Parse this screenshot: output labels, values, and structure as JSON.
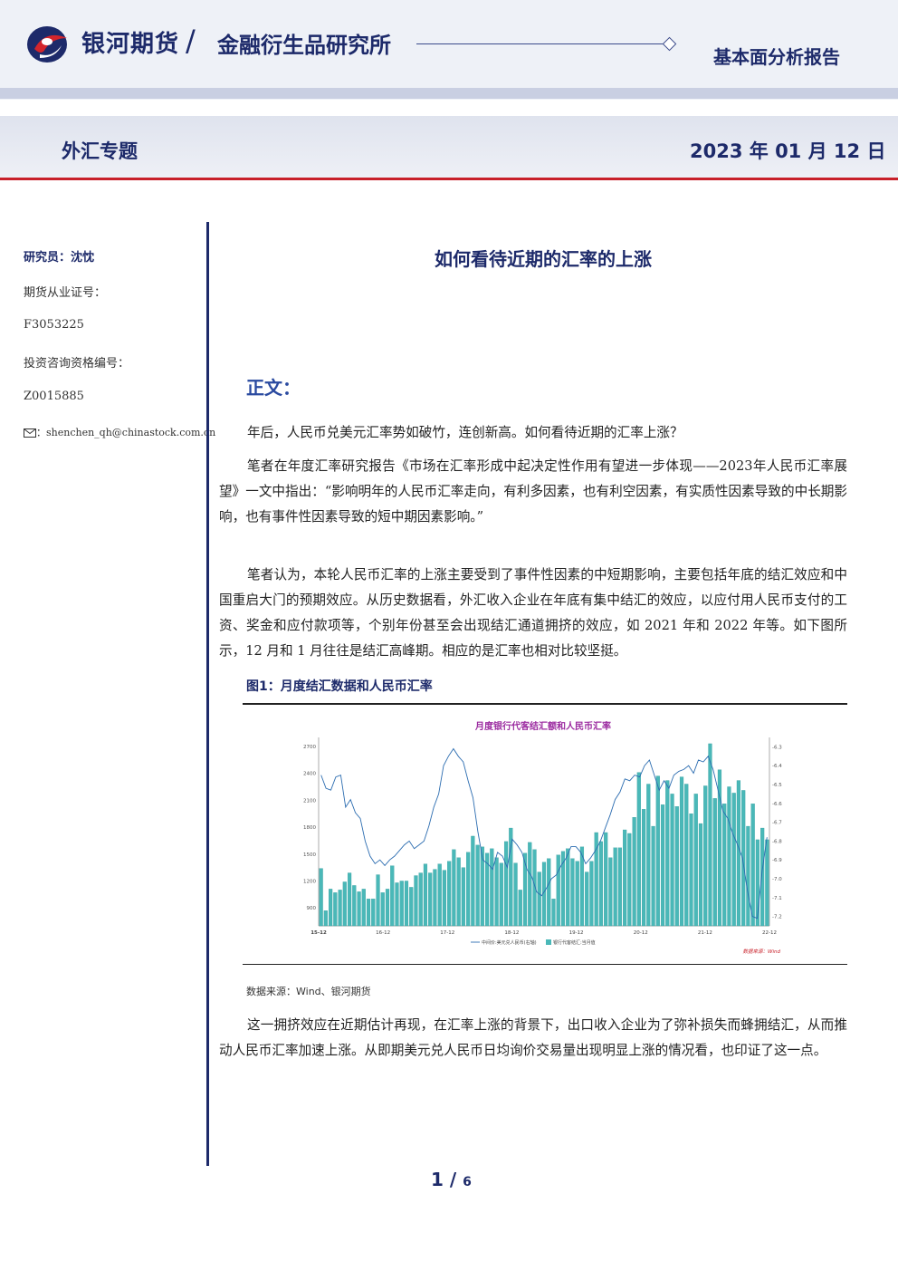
{
  "header": {
    "brand": "银河期货",
    "slash": "/",
    "institute": "金融衍生品研究所",
    "report_type": "基本面分析报告",
    "topic": "外汇专题",
    "date": "2023 年 01 月 12 日"
  },
  "sidebar": {
    "analyst": "研究员：沈忱",
    "license_label": "期货从业证号：",
    "license_no": "F3053225",
    "consult_label": "投资咨询资格编号：",
    "consult_no": "Z0015885",
    "email": "：shenchen_qh@chinastock.com.cn"
  },
  "main": {
    "title": "如何看待近期的汇率的上涨",
    "section": "正文：",
    "para1": "年后，人民币兑美元汇率势如破竹，连创新高。如何看待近期的汇率上涨？",
    "para2": "笔者在年度汇率研究报告《市场在汇率形成中起决定性作用有望进一步体现——2023年人民币汇率展望》一文中指出：“影响明年的人民币汇率走向，有利多因素，也有利空因素，有实质性因素导致的中长期影响，也有事件性因素导致的短中期因素影响。”",
    "para3": "笔者认为，本轮人民币汇率的上涨主要受到了事件性因素的中短期影响，主要包括年底的结汇效应和中国重启大门的预期效应。从历史数据看，外汇收入企业在年底有集中结汇的效应，以应付用人民币支付的工资、奖金和应付款项等，个别年份甚至会出现结汇通道拥挤的效应，如 2021 年和 2022 年等。如下图所示，12 月和 1 月往往是结汇高峰期。相应的是汇率也相对比较坚挺。",
    "fig_caption": "图1：月度结汇数据和人民币汇率",
    "fig_source": "数据来源：Wind、银河期货",
    "para4": "这一拥挤效应在近期估计再现，在汇率上涨的背景下，出口收入企业为了弥补损失而蜂拥结汇，从而推动人民币汇率加速上涨。从即期美元兑人民币日均询价交易量出现明显上涨的情况看，也印证了这一点。"
  },
  "page": {
    "current": "1",
    "sep": "/",
    "total": "6"
  },
  "chart_data": {
    "type": "bar",
    "title": "月度银行代客结汇额和人民币汇率",
    "x_ticks": [
      "15-12",
      "16-12",
      "17-12",
      "18-12",
      "19-12",
      "20-12",
      "21-12",
      "22-12"
    ],
    "y_left_ticks": [
      "2700",
      "2400",
      "2100",
      "1800",
      "1500",
      "1200",
      "900"
    ],
    "y_left_range": [
      700,
      2800
    ],
    "y_right_ticks": [
      "-6.3",
      "-6.4",
      "-6.5",
      "-6.6",
      "-6.7",
      "-6.8",
      "-6.9",
      "-7.0",
      "-7.1",
      "-7.2"
    ],
    "y_right_range": [
      -7.25,
      -6.25
    ],
    "legend": [
      "中间价:美元兑人民币(右轴)",
      "银行代客结汇:当月值"
    ],
    "source_note": "数据来源：Wind",
    "series": [
      {
        "name": "银行代客结汇:当月值",
        "axis": "left",
        "values": [
          1340,
          870,
          1110,
          1070,
          1100,
          1190,
          1290,
          1150,
          1080,
          1110,
          1000,
          1000,
          1270,
          1070,
          1110,
          1370,
          1180,
          1200,
          1200,
          1130,
          1260,
          1290,
          1390,
          1290,
          1330,
          1390,
          1320,
          1420,
          1550,
          1460,
          1350,
          1520,
          1700,
          1600,
          1580,
          1510,
          1560,
          1460,
          1400,
          1640,
          1790,
          1400,
          1100,
          1510,
          1630,
          1550,
          1300,
          1410,
          1450,
          1000,
          1490,
          1530,
          1560,
          1450,
          1420,
          1580,
          1300,
          1420,
          1740,
          1640,
          1740,
          1460,
          1570,
          1570,
          1770,
          1730,
          1910,
          2410,
          2000,
          2280,
          1810,
          2370,
          2050,
          2320,
          2170,
          2030,
          2360,
          2280,
          1950,
          2170,
          1840,
          2260,
          2730,
          2120,
          2440,
          2060,
          2250,
          2180,
          2320,
          2210,
          1810,
          2060,
          1660,
          1790,
          1660
        ]
      },
      {
        "name": "中间价:美元兑人民币(右轴)",
        "axis": "right",
        "values": [
          -6.45,
          -6.52,
          -6.53,
          -6.46,
          -6.45,
          -6.62,
          -6.58,
          -6.65,
          -6.68,
          -6.8,
          -6.88,
          -6.92,
          -6.9,
          -6.93,
          -6.9,
          -6.88,
          -6.85,
          -6.82,
          -6.8,
          -6.84,
          -6.82,
          -6.8,
          -6.72,
          -6.62,
          -6.55,
          -6.4,
          -6.35,
          -6.31,
          -6.35,
          -6.38,
          -6.48,
          -6.57,
          -6.75,
          -6.9,
          -6.92,
          -6.95,
          -6.86,
          -6.88,
          -6.94,
          -6.79,
          -6.82,
          -6.86,
          -6.95,
          -6.99,
          -7.07,
          -7.09,
          -7.05,
          -7.0,
          -6.98,
          -6.93,
          -6.89,
          -6.83,
          -6.83,
          -6.86,
          -6.92,
          -6.89,
          -6.85,
          -6.8,
          -6.73,
          -6.66,
          -6.58,
          -6.54,
          -6.47,
          -6.48,
          -6.45,
          -6.46,
          -6.4,
          -6.37,
          -6.45,
          -6.53,
          -6.48,
          -6.52,
          -6.45,
          -6.43,
          -6.42,
          -6.4,
          -6.44,
          -6.37,
          -6.38,
          -6.35,
          -6.42,
          -6.53,
          -6.64,
          -6.68,
          -6.76,
          -6.82,
          -6.89,
          -7.06,
          -7.2,
          -7.21,
          -6.96,
          -6.78
        ]
      }
    ]
  }
}
